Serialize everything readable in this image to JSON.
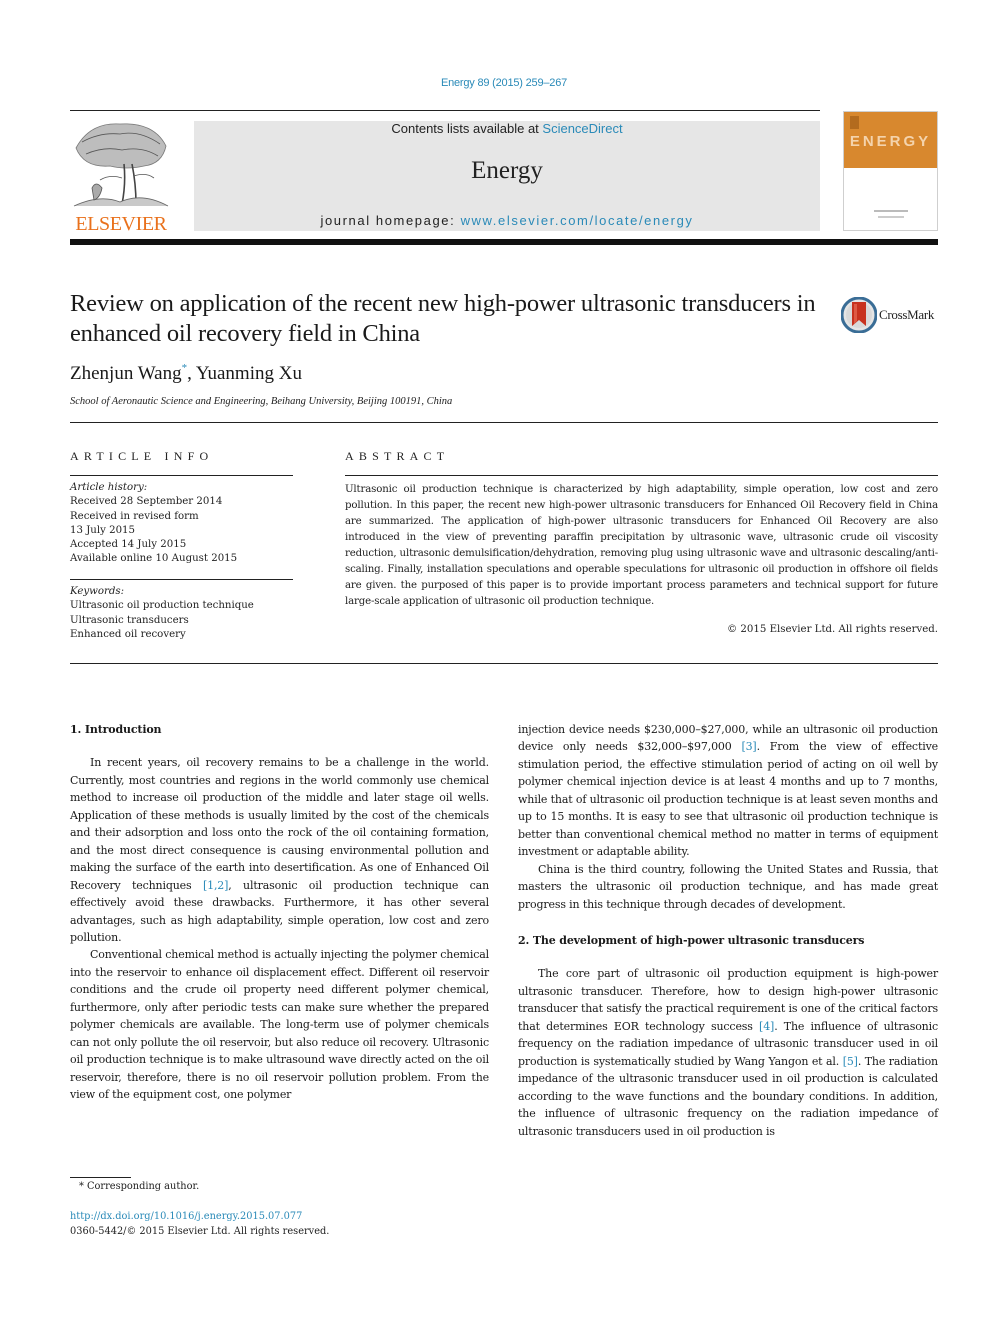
{
  "journal_ref": "Energy 89 (2015) 259–267",
  "header": {
    "publisher_logo_word": "ELSEVIER",
    "contents_prefix": "Contents lists available at ",
    "contents_link": "ScienceDirect",
    "journal_name": "Energy",
    "homepage_prefix": "journal homepage: ",
    "homepage_link": "www.elsevier.com/locate/energy",
    "cover_word": "ENERGY"
  },
  "article": {
    "title": "Review on application of the recent new high-power ultrasonic transducers in enhanced oil recovery field in China",
    "author_1": "Zhenjun Wang",
    "author_1_mark": "*",
    "author_sep": ", ",
    "author_2": "Yuanming Xu",
    "affiliation": "School of Aeronautic Science and Engineering, Beihang University, Beijing 100191, China",
    "crossmark_label": "CrossMark"
  },
  "article_info": {
    "heading": "ARTICLE INFO",
    "history_label": "Article history:",
    "history": [
      "Received 28 September 2014",
      "Received in revised form",
      "13 July 2015",
      "Accepted 14 July 2015",
      "Available online 10 August 2015"
    ],
    "keywords_label": "Keywords:",
    "keywords": [
      "Ultrasonic oil production technique",
      "Ultrasonic transducers",
      "Enhanced oil recovery"
    ]
  },
  "abstract": {
    "heading": "ABSTRACT",
    "text": "Ultrasonic oil production technique is characterized by high adaptability, simple operation, low cost and zero pollution. In this paper, the recent new high-power ultrasonic transducers for Enhanced Oil Recovery field in China are summarized. The application of high-power ultrasonic transducers for Enhanced Oil Recovery are also introduced in the view of preventing paraffin precipitation by ultrasonic wave, ultrasonic crude oil viscosity reduction, ultrasonic demulsification/dehydration, removing plug using ultrasonic wave and ultrasonic descaling/anti-scaling. Finally, installation speculations and operable speculations for ultrasonic oil production in offshore oil fields are given. the purposed of this paper is to provide important process parameters and technical support for future large-scale application of ultrasonic oil production technique.",
    "copyright": "© 2015 Elsevier Ltd. All rights reserved."
  },
  "body": {
    "section_1_heading": "1.  Introduction",
    "s1_p1_a": "In recent years, oil recovery remains to be a challenge in the world. Currently, most countries and regions in the world commonly use chemical method to increase oil production of the middle and later stage oil wells. Application of these methods is usually limited by the cost of the chemicals and their adsorption and loss onto the rock of the oil containing formation, and the most direct consequence is causing environmental pollution and making the surface of the earth into desertification. As one of Enhanced Oil Recovery techniques ",
    "s1_p1_ref": "[1,2]",
    "s1_p1_b": ", ultrasonic oil production technique can effectively avoid these drawbacks. Furthermore, it has other several advantages, such as high adaptability, simple operation, low cost and zero pollution.",
    "s1_p2": "Conventional chemical method is actually injecting the polymer chemical into the reservoir to enhance oil displacement effect. Different oil reservoir conditions and the crude oil property need different polymer chemical, furthermore, only after periodic tests can make sure whether the prepared polymer chemicals are available. The long-term use of polymer chemicals can not only pollute the oil reservoir, but also reduce oil recovery. Ultrasonic oil production technique is to make ultrasound wave directly acted on the oil reservoir, therefore, there is no oil reservoir pollution problem. From the view of the equipment cost, one polymer",
    "s1_p2_cont_a": "injection device needs $230,000–$27,000, while an ultrasonic oil production device only needs $32,000–$97,000 ",
    "s1_p2_cont_ref": "[3]",
    "s1_p2_cont_b": ". From the view of effective stimulation period, the effective stimulation period of acting on oil well by polymer chemical injection device is at least 4 months and up to 7 months, while that of ultrasonic oil production technique is at least seven months and up to 15 months. It is easy to see that ultrasonic oil production technique is better than conventional chemical method no matter in terms of equipment investment or adaptable ability.",
    "s1_p3": "China is the third country, following the United States and Russia, that masters the ultrasonic oil production technique, and has made great progress in this technique through decades of development.",
    "section_2_heading": "2.  The development of high-power ultrasonic transducers",
    "s2_p1_a": "The core part of ultrasonic oil production equipment is high-power ultrasonic transducer. Therefore, how to design high-power ultrasonic transducer that satisfy the practical requirement is one of the critical factors that determines EOR technology success ",
    "s2_p1_ref1": "[4]",
    "s2_p1_b": ". The influence of ultrasonic frequency on the radiation impedance of ultrasonic transducer used in oil production is systematically studied by Wang Yangon et al. ",
    "s2_p1_ref2": "[5]",
    "s2_p1_c": ". The radiation impedance of the ultrasonic transducer used in oil production is calculated according to the wave functions and the boundary conditions. In addition, the influence of ultrasonic frequency on the radiation impedance of ultrasonic transducers used in oil production is"
  },
  "footer": {
    "footnote": "*  Corresponding author.",
    "doi": "http://dx.doi.org/10.1016/j.energy.2015.07.077",
    "issn": "0360-5442/© 2015 Elsevier Ltd. All rights reserved."
  }
}
